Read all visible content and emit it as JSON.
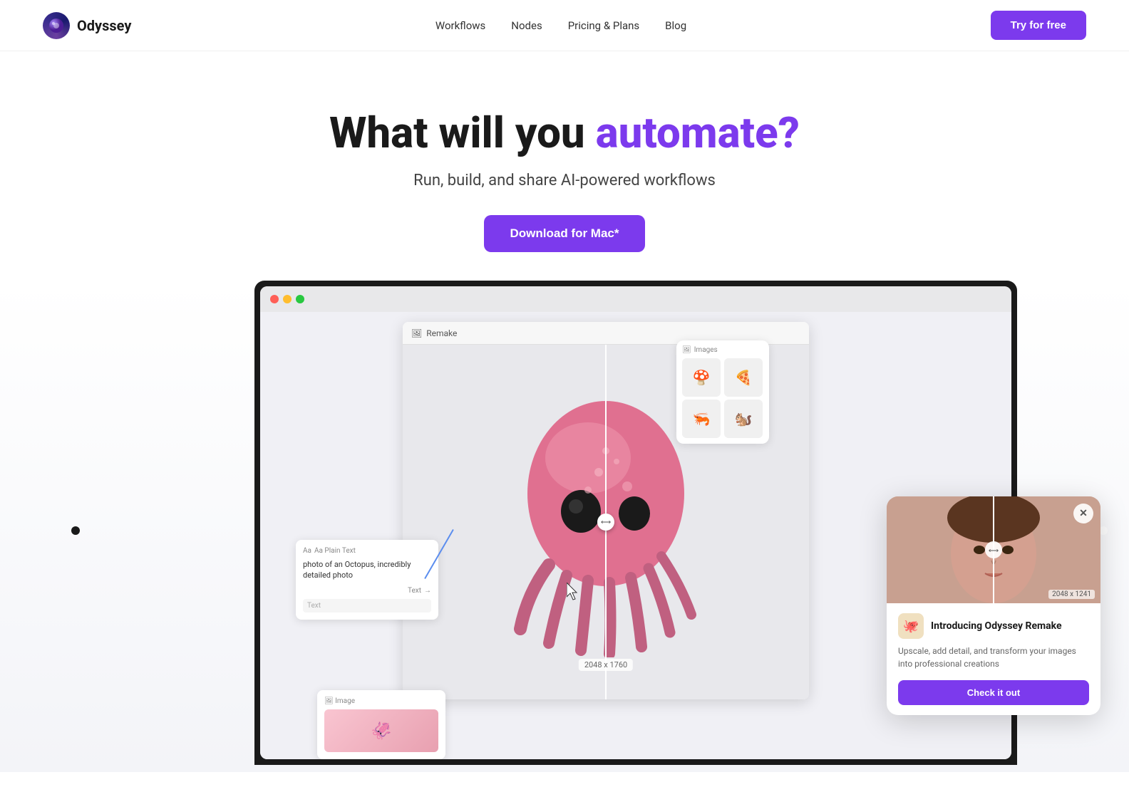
{
  "navbar": {
    "logo_text": "Odyssey",
    "nav_links": [
      "Workflows",
      "Nodes",
      "Pricing & Plans",
      "Blog"
    ],
    "try_btn": "Try for free"
  },
  "hero": {
    "title_part1": "What will you ",
    "title_highlight": "automate?",
    "subtitle": "Run, build, and share AI-powered workflows",
    "download_btn": "Download for Mac*"
  },
  "workflow_app": {
    "window_title": "Remake",
    "image_node_title": "Image",
    "text_node_title": "Aa Plain Text",
    "text_node_content": "photo of an Octopus, incredibly detailed photo",
    "text_node_label": "Text",
    "text_input_placeholder": "Text",
    "dimension_label": "2048 x 1760",
    "image_dimension": "2048 x 1241",
    "images_panel_title": "Images"
  },
  "popup": {
    "title": "Introducing Odyssey Remake",
    "description": "Upscale, add detail, and transform your images into professional creations",
    "check_btn": "Check it out",
    "dim_label": "2048 x 1241"
  },
  "colors": {
    "accent": "#7c3aed",
    "accent_hover": "#6d28d9",
    "orange": "#f97316",
    "connector": "#5b8dee"
  }
}
